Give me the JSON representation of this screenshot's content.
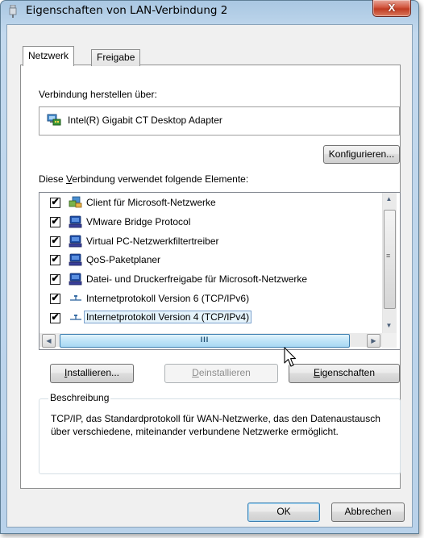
{
  "window": {
    "title": "Eigenschaften von LAN-Verbindung 2",
    "close_glyph": "X"
  },
  "tabs": [
    {
      "label": "Netzwerk",
      "selected": true
    },
    {
      "label": "Freigabe",
      "selected": false
    }
  ],
  "connect_via": {
    "label": "Verbindung herstellen über:",
    "adapter": "Intel(R) Gigabit CT Desktop Adapter",
    "configure_button": "Konfigurieren..."
  },
  "elements": {
    "label_before": "Diese ",
    "label_underline": "V",
    "label_after": "erbindung verwendet folgende Elemente:",
    "items": [
      {
        "label": "Client für Microsoft-Netzwerke",
        "checked": true,
        "icon": "network-client-icon",
        "selected": false
      },
      {
        "label": "VMware Bridge Protocol",
        "checked": true,
        "icon": "network-service-icon",
        "selected": false
      },
      {
        "label": "Virtual PC-Netzwerkfiltertreiber",
        "checked": true,
        "icon": "network-service-icon",
        "selected": false
      },
      {
        "label": "QoS-Paketplaner",
        "checked": true,
        "icon": "network-service-icon",
        "selected": false
      },
      {
        "label": "Datei- und Druckerfreigabe für Microsoft-Netzwerke",
        "checked": true,
        "icon": "network-service-icon",
        "selected": false
      },
      {
        "label": "Internetprotokoll Version 6 (TCP/IPv6)",
        "checked": true,
        "icon": "protocol-icon",
        "selected": false
      },
      {
        "label": "Internetprotokoll Version 4 (TCP/IPv4)",
        "checked": true,
        "icon": "protocol-icon",
        "selected": true
      }
    ],
    "check_glyph": "✔",
    "hscroll_grip": "III"
  },
  "actions": {
    "install_u": "I",
    "install_rest": "nstallieren...",
    "uninstall_u": "D",
    "uninstall_rest": "einstallieren",
    "properties_u": "E",
    "properties_rest": "igenschaften"
  },
  "description": {
    "legend": "Beschreibung",
    "text": "TCP/IP, das Standardprotokoll für WAN-Netzwerke, das den Datenaustausch über verschiedene, miteinander verbundene Netzwerke ermöglicht."
  },
  "footer": {
    "ok": "OK",
    "cancel": "Abbrechen"
  },
  "colors": {
    "selection_fill": "#e5f3fb",
    "selection_border": "#7da2ce",
    "title_bar": "#b9d2ea",
    "close_button": "#c03c22"
  }
}
